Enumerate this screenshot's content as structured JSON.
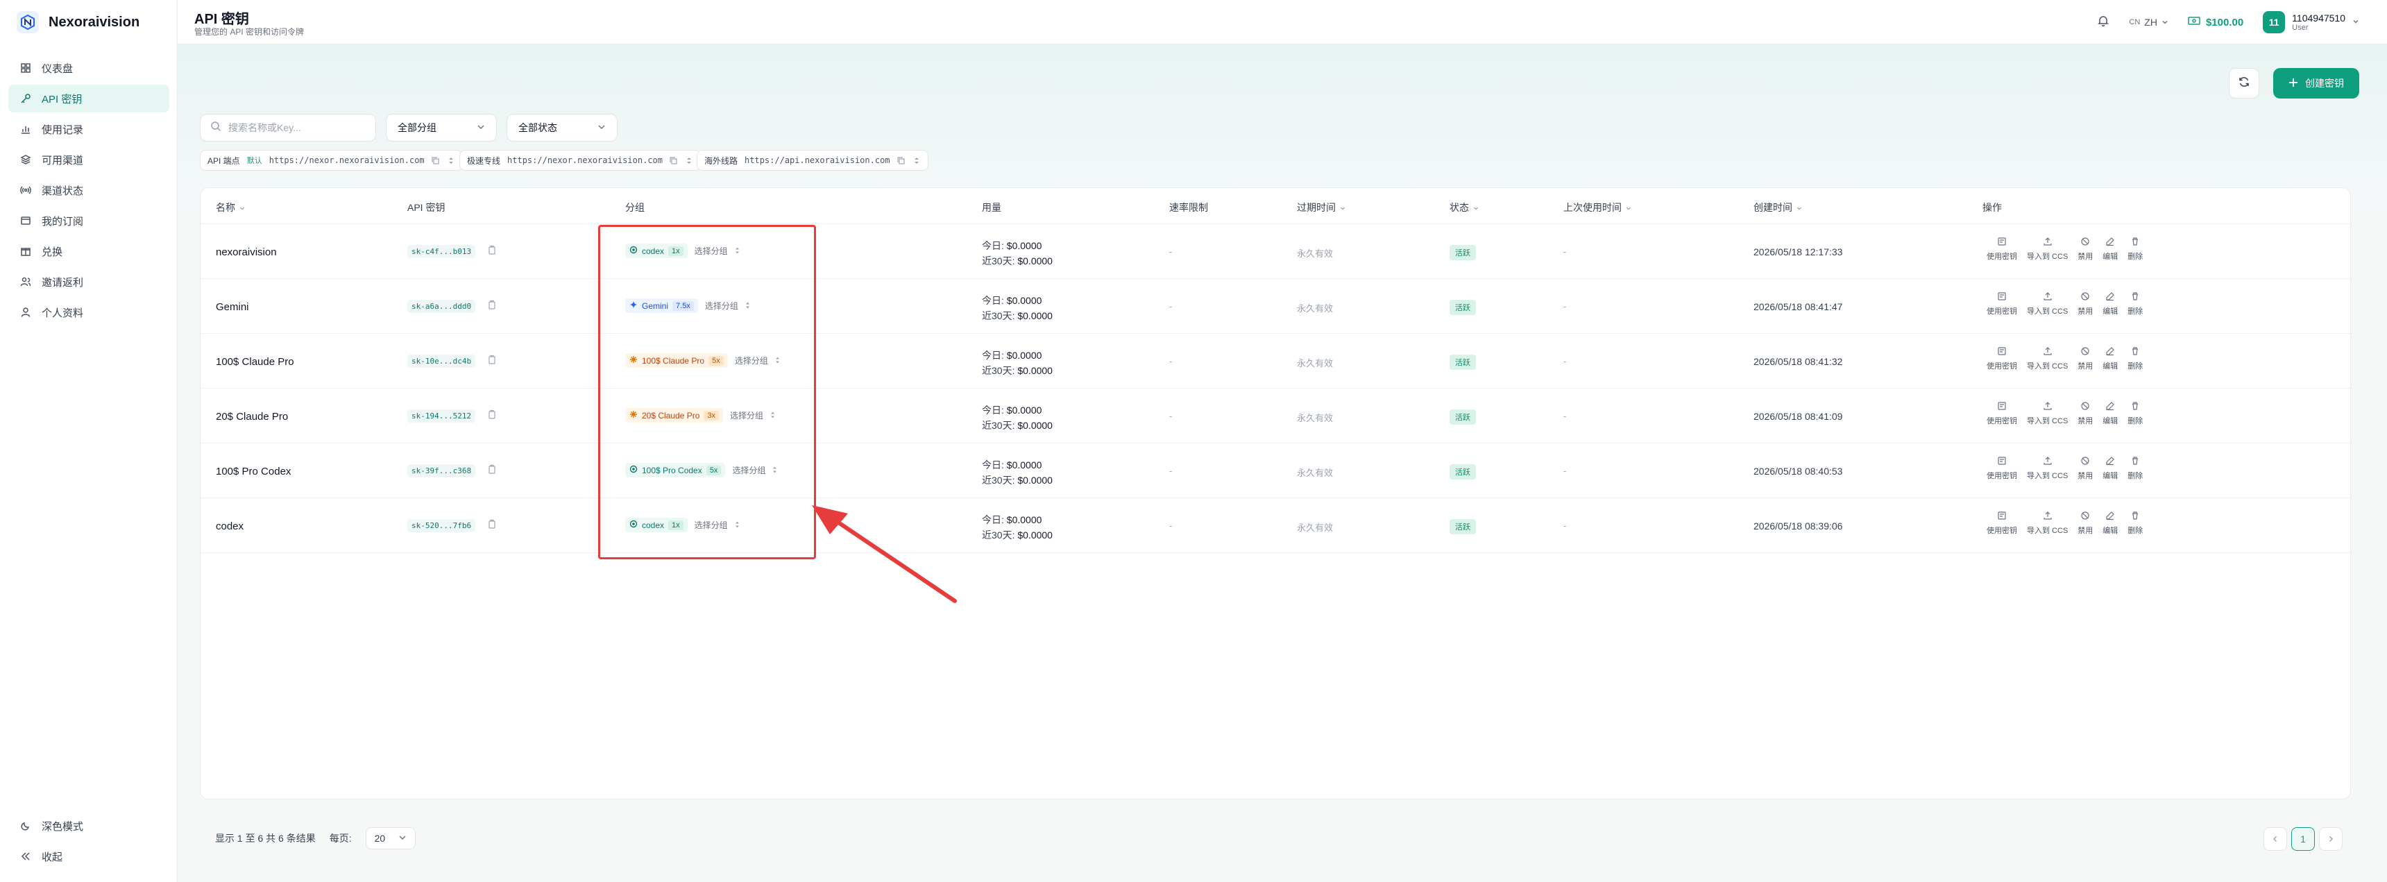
{
  "brand": {
    "name": "Nexoraivision"
  },
  "sidebar": {
    "items": [
      {
        "label": "仪表盘",
        "icon": "dashboard-icon"
      },
      {
        "label": "API 密钥",
        "icon": "key-icon",
        "active": true
      },
      {
        "label": "使用记录",
        "icon": "chart-icon"
      },
      {
        "label": "可用渠道",
        "icon": "layers-icon"
      },
      {
        "label": "渠道状态",
        "icon": "signal-icon"
      },
      {
        "label": "我的订阅",
        "icon": "card-icon"
      },
      {
        "label": "兑换",
        "icon": "gift-icon"
      },
      {
        "label": "邀请返利",
        "icon": "users-icon"
      },
      {
        "label": "个人资料",
        "icon": "user-icon"
      }
    ],
    "bottom": [
      {
        "label": "深色模式",
        "icon": "moon-icon"
      },
      {
        "label": "收起",
        "icon": "collapse-icon"
      }
    ]
  },
  "header": {
    "title": "API 密钥",
    "subtitle": "管理您的 API 密钥和访问令牌",
    "lang_code": "CN",
    "lang": "ZH",
    "balance": "$100.00",
    "user": {
      "avatar": "11",
      "name": "1104947510",
      "role": "User"
    }
  },
  "toolbar": {
    "create_label": "创建密钥",
    "search_placeholder": "搜索名称或Key...",
    "group_filter": "全部分组",
    "status_filter": "全部状态"
  },
  "endpoints": [
    {
      "label": "API 端点",
      "tag": "默认",
      "url": "https://nexor.nexoraivision.com"
    },
    {
      "label": "极速专线",
      "tag": "",
      "url": "https://nexor.nexoraivision.com"
    },
    {
      "label": "海外线路",
      "tag": "",
      "url": "https://api.nexoraivision.com"
    }
  ],
  "table": {
    "columns": [
      "名称",
      "API 密钥",
      "分组",
      "用量",
      "速率限制",
      "过期时间",
      "状态",
      "上次使用时间",
      "创建时间",
      "操作"
    ],
    "usage_today_label": "今日:",
    "usage_30d_label": "近30天:",
    "choose_group": "选择分组",
    "actions": [
      "使用密钥",
      "导入到 CCS",
      "禁用",
      "编辑",
      "删除"
    ],
    "rows": [
      {
        "name": "nexoraivision",
        "key": "sk-c4f...b013",
        "group": "codex",
        "mult": "1x",
        "color": "green",
        "today": "$0.0000",
        "d30": "$0.0000",
        "rate": "-",
        "expire": "永久有效",
        "status": "活跃",
        "last": "-",
        "created": "2026/05/18 12:17:33"
      },
      {
        "name": "Gemini",
        "key": "sk-a6a...ddd0",
        "group": "Gemini",
        "mult": "7.5x",
        "color": "blue",
        "today": "$0.0000",
        "d30": "$0.0000",
        "rate": "-",
        "expire": "永久有效",
        "status": "活跃",
        "last": "-",
        "created": "2026/05/18 08:41:47"
      },
      {
        "name": "100$ Claude Pro",
        "key": "sk-10e...dc4b",
        "group": "100$ Claude Pro",
        "mult": "5x",
        "color": "orange",
        "today": "$0.0000",
        "d30": "$0.0000",
        "rate": "-",
        "expire": "永久有效",
        "status": "活跃",
        "last": "-",
        "created": "2026/05/18 08:41:32"
      },
      {
        "name": "20$ Claude Pro",
        "key": "sk-194...5212",
        "group": "20$ Claude Pro",
        "mult": "3x",
        "color": "orange",
        "today": "$0.0000",
        "d30": "$0.0000",
        "rate": "-",
        "expire": "永久有效",
        "status": "活跃",
        "last": "-",
        "created": "2026/05/18 08:41:09"
      },
      {
        "name": "100$ Pro Codex",
        "key": "sk-39f...c368",
        "group": "100$ Pro Codex",
        "mult": "5x",
        "color": "green",
        "today": "$0.0000",
        "d30": "$0.0000",
        "rate": "-",
        "expire": "永久有效",
        "status": "活跃",
        "last": "-",
        "created": "2026/05/18 08:40:53"
      },
      {
        "name": "codex",
        "key": "sk-520...7fb6",
        "group": "codex",
        "mult": "1x",
        "color": "green",
        "today": "$0.0000",
        "d30": "$0.0000",
        "rate": "-",
        "expire": "永久有效",
        "status": "活跃",
        "last": "-",
        "created": "2026/05/18 08:39:06"
      }
    ]
  },
  "pagination": {
    "summary": "显示 1 至 6 共 6 条结果",
    "per_page_label": "每页:",
    "per_page": "20",
    "current_page": "1"
  },
  "colors": {
    "accent": "#0f9f7f",
    "highlight": "#e63c3c"
  }
}
